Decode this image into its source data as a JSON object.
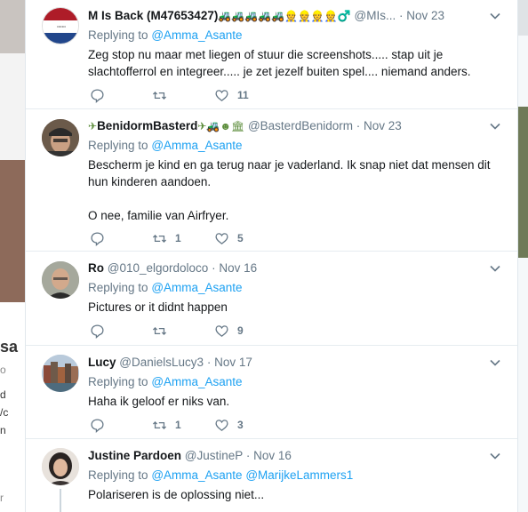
{
  "background": {
    "left_fragments": [
      "sa",
      "o",
      "d",
      "/c",
      "n",
      "r"
    ],
    "right_fragments": []
  },
  "tweets": [
    {
      "name": "M Is Back (M47653427)",
      "badges": "🚜🚜🚜🚜🚜👷👷👷👷♂️",
      "handle": "@MIs...",
      "time": "Nov 23",
      "replying_label": "Replying to",
      "replying_to": [
        "@Amma_Asante"
      ],
      "text": "Zeg stop nu maar met liegen of stuur die screenshots..... stap uit je slachtofferrol en integreer..... je zet jezelf buiten spel.... niemand anders.",
      "counts": {
        "reply": "",
        "retweet": "",
        "like": "11"
      },
      "avatar": "flag"
    },
    {
      "name": "BenidormBasterd",
      "name_prefix": "✈",
      "badges": "✈🚜☻🏛",
      "handle": "@BasterdBenidorm",
      "time": "Nov 23",
      "replying_label": "Replying to",
      "replying_to": [
        "@Amma_Asante"
      ],
      "text": "Bescherm je kind en ga terug naar je vaderland. Ik snap niet dat mensen dit hun kinderen aandoen.\n\nO nee, familie van Airfryer.",
      "counts": {
        "reply": "",
        "retweet": "1",
        "like": "5"
      },
      "avatar": "man-cap"
    },
    {
      "name": "Ro",
      "badges": "",
      "handle": "@010_elgordoloco",
      "time": "Nov 16",
      "replying_label": "Replying to",
      "replying_to": [
        "@Amma_Asante"
      ],
      "text": "Pictures or it didnt happen",
      "counts": {
        "reply": "",
        "retweet": "",
        "like": "9"
      },
      "avatar": "bald-man"
    },
    {
      "name": "Lucy",
      "badges": "",
      "handle": "@DanielsLucy3",
      "time": "Nov 17",
      "replying_label": "Replying to",
      "replying_to": [
        "@Amma_Asante"
      ],
      "text": "Haha ik geloof er niks van.",
      "counts": {
        "reply": "",
        "retweet": "1",
        "like": "3"
      },
      "avatar": "canal-houses"
    },
    {
      "name": "Justine Pardoen",
      "badges": "",
      "handle": "@JustineP",
      "time": "Nov 16",
      "replying_label": "Replying to",
      "replying_to": [
        "@Amma_Asante",
        "@MarijkeLammers1"
      ],
      "text": "Polariseren is de oplossing niet...",
      "counts": {
        "reply": "",
        "retweet": "",
        "like": ""
      },
      "avatar": "woman-dark-hair"
    }
  ],
  "colors": {
    "link": "#1da1f2",
    "muted": "#657786",
    "text": "#14171a",
    "divider": "#e6ecf0"
  }
}
